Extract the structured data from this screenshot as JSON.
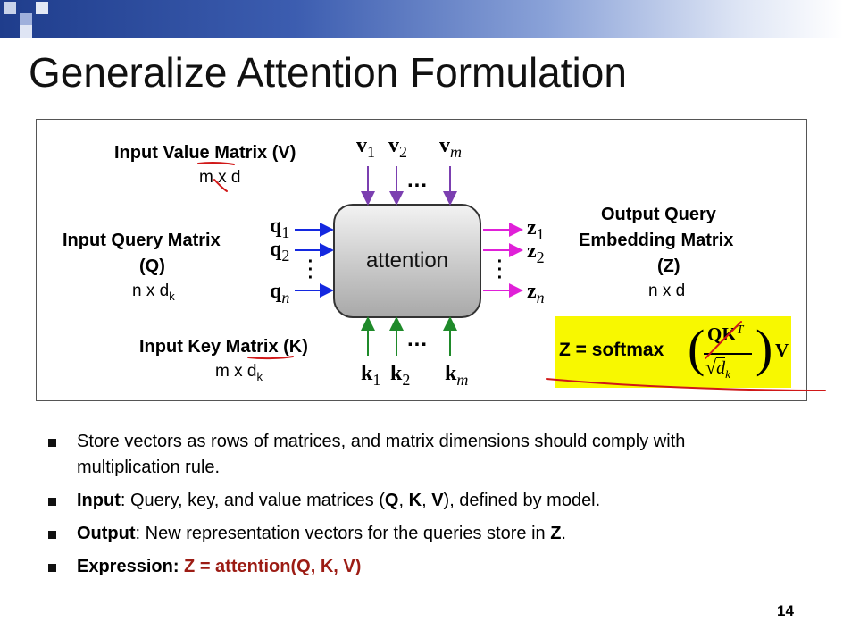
{
  "title": "Generalize Attention Formulation",
  "diagram": {
    "value_label": "Input Value Matrix (V)",
    "value_dim": "m x d",
    "query_label_1": "Input Query Matrix",
    "query_label_2": "(Q)",
    "query_dim_base": "n x d",
    "query_dim_sub": "k",
    "key_label": "Input Key Matrix (K)",
    "key_dim_base": "m x d",
    "key_dim_sub": "k",
    "output_label_1": "Output Query",
    "output_label_2": "Embedding Matrix",
    "output_label_3": "(Z)",
    "output_dim": "n x d",
    "box_label": "attention",
    "v_vectors": [
      {
        "base": "v",
        "sub": "1"
      },
      {
        "base": "v",
        "sub": "2"
      },
      {
        "base": "v",
        "sub": "m"
      }
    ],
    "q_vectors": [
      {
        "base": "q",
        "sub": "1"
      },
      {
        "base": "q",
        "sub": "2"
      },
      {
        "base": "q",
        "sub": "n"
      }
    ],
    "k_vectors": [
      {
        "base": "k",
        "sub": "1"
      },
      {
        "base": "k",
        "sub": "2"
      },
      {
        "base": "k",
        "sub": "m"
      }
    ],
    "z_vectors": [
      {
        "base": "z",
        "sub": "1"
      },
      {
        "base": "z",
        "sub": "2"
      },
      {
        "base": "z",
        "sub": "n"
      }
    ],
    "dots": "...",
    "formula": {
      "lhs": "Z = softmax",
      "numerator": "QK",
      "numerator_sup": "T",
      "denominator": "d",
      "denominator_sub": "k",
      "rhs": "V"
    },
    "colors": {
      "value_arrow": "#7b3fb0",
      "query_arrow": "#1428e0",
      "key_arrow": "#1f8a2a",
      "output_arrow": "#e020d8",
      "highlight": "#f8f800",
      "ink": "#d01818"
    }
  },
  "bullets": [
    {
      "parts": [
        {
          "text": "Store vectors as rows of matrices, and matrix dimensions should comply with multiplication rule.",
          "style": ""
        }
      ]
    },
    {
      "parts": [
        {
          "text": "Input",
          "style": "b"
        },
        {
          "text": ": Query, key, and value matrices (",
          "style": ""
        },
        {
          "text": "Q",
          "style": "b"
        },
        {
          "text": ", ",
          "style": ""
        },
        {
          "text": "K",
          "style": "b"
        },
        {
          "text": ", ",
          "style": ""
        },
        {
          "text": "V",
          "style": "b"
        },
        {
          "text": "), defined by model.",
          "style": ""
        }
      ]
    },
    {
      "parts": [
        {
          "text": "Output",
          "style": "b"
        },
        {
          "text": ": New representation vectors for the queries store in ",
          "style": ""
        },
        {
          "text": "Z",
          "style": "b"
        },
        {
          "text": ".",
          "style": ""
        }
      ]
    },
    {
      "parts": [
        {
          "text": "Expression: ",
          "style": "b"
        },
        {
          "text": "Z = attention(Q, K, V)",
          "style": "b red"
        }
      ]
    }
  ],
  "page_number": "14"
}
